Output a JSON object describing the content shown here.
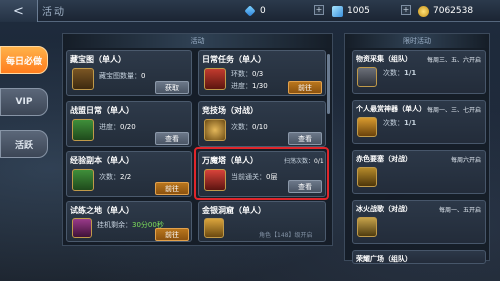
{
  "header": {
    "title": "活动",
    "back_label": "<"
  },
  "resources": {
    "diamond": "0",
    "crystal": "1005",
    "gold": "7062538"
  },
  "left_tabs": [
    {
      "label": "每日必做",
      "active": true
    },
    {
      "label": "VIP",
      "active": false
    },
    {
      "label": "活跃",
      "active": false
    }
  ],
  "left_panel": {
    "title": "活动",
    "cards": [
      {
        "name": "藏宝图（单人）",
        "info": "藏宝图数量：",
        "value": "0",
        "button": "获取"
      },
      {
        "name": "日常任务（单人）",
        "info": "环数：",
        "value": "0/3",
        "info2": "进度：",
        "value2": "1/30",
        "button": "前往"
      },
      {
        "name": "战盟日常（单人）",
        "info": "进度：",
        "value": "0/20",
        "button": "查看"
      },
      {
        "name": "竞技场（对战）",
        "info": "次数：",
        "value": "0/10",
        "button": "查看"
      },
      {
        "name": "经验副本（单人）",
        "info": "次数：",
        "value": "2/2",
        "button": "前往"
      },
      {
        "name": "万魔塔（单人）",
        "info": "当前通关：",
        "value": "0层",
        "extra": "扫荡次数：",
        "extra_value": "0/1",
        "button": "查看"
      },
      {
        "name": "试练之地（单人）",
        "info": "挂机剩余：",
        "value": "30分00秒",
        "button": "前往"
      },
      {
        "name": "金银洞窟（单人）",
        "info": "角色【148】级开启"
      }
    ]
  },
  "right_panel": {
    "title": "限时活动",
    "cards": [
      {
        "name": "物资采集（组队）",
        "days": "每周三、五、六开启",
        "info": "次数：",
        "value": "1/1",
        "title_color": "#ffffff"
      },
      {
        "name": "个人悬赏神器（单人）",
        "days": "每周一、三、七开启",
        "info": "次数：",
        "value": "1/1",
        "title_color": "#ffffff"
      },
      {
        "name": "赤色要塞（对战）",
        "days": "每周六开启",
        "title_color": "#ffffff"
      },
      {
        "name": "冰火战歌（对战）",
        "days": "每周一、五开启",
        "title_color": "#ffffff"
      },
      {
        "name": "荣耀广场（组队）",
        "days": "",
        "title_color": "#ffffff"
      }
    ]
  },
  "colors": {
    "accent": "#ff8a2a",
    "highlight_border": "#e0262b",
    "value_green": "#7ee05b"
  }
}
